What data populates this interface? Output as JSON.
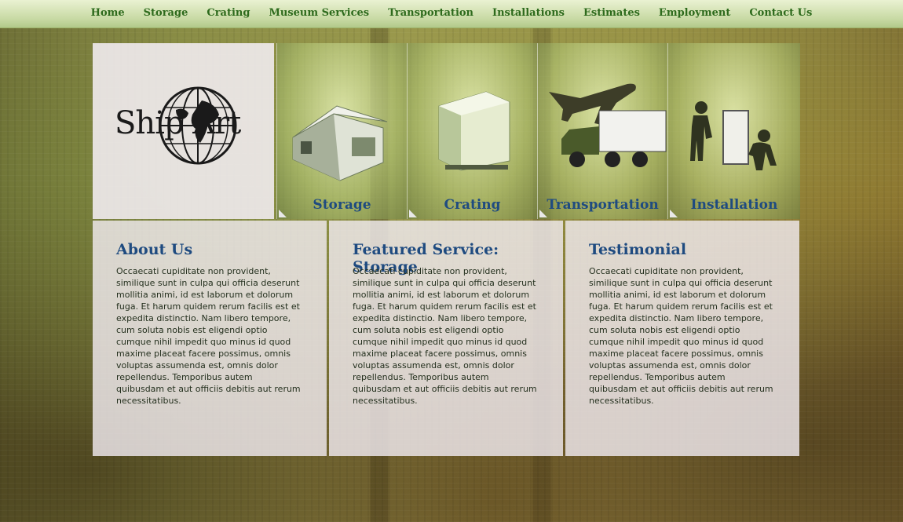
{
  "nav": {
    "items": [
      "Home",
      "Storage",
      "Crating",
      "Museum Services",
      "Transportation",
      "Installations",
      "Estimates",
      "Employment",
      "Contact Us"
    ]
  },
  "logo": {
    "text": "Ship Art"
  },
  "services": [
    {
      "label": "Storage",
      "icon": "warehouse-icon"
    },
    {
      "label": "Crating",
      "icon": "crate-icon"
    },
    {
      "label": "Transportation",
      "icon": "airplane-truck-icon"
    },
    {
      "label": "Installation",
      "icon": "installer-icon"
    }
  ],
  "panels": [
    {
      "title": "About Us",
      "body": "Occaecati cupiditate non provident, similique sunt in culpa qui officia deserunt mollitia animi, id est laborum et dolorum fuga. Et harum quidem rerum facilis est et expedita distinctio. Nam libero tempore, cum soluta nobis est eligendi optio cumque nihil impedit quo minus id quod maxime placeat facere possimus, omnis voluptas assumenda est, omnis dolor repellendus. Temporibus autem quibusdam et aut officiis debitis aut rerum necessitatibus."
    },
    {
      "title": "Featured Service: Storage",
      "body": "Occaecati cupiditate non provident, similique sunt in culpa qui officia deserunt mollitia animi, id est laborum et dolorum fuga. Et harum quidem rerum facilis est et expedita distinctio. Nam libero tempore, cum soluta nobis est eligendi optio cumque nihil impedit quo minus id quod maxime placeat facere possimus, omnis voluptas assumenda est, omnis dolor repellendus. Temporibus autem quibusdam et aut officiis debitis aut rerum necessitatibus."
    },
    {
      "title": "Testimonial",
      "body": "Occaecati cupiditate non provident, similique sunt in culpa qui officia deserunt mollitia animi, id est laborum et dolorum fuga. Et harum quidem rerum facilis est et expedita distinctio. Nam libero tempore, cum soluta nobis est eligendi optio cumque nihil impedit quo minus id quod maxime placeat facere possimus, omnis voluptas assumenda est, omnis dolor repellendus. Temporibus autem quibusdam et aut officiis debitis aut rerum necessitatibus."
    }
  ],
  "colors": {
    "nav_text": "#2d6a1c",
    "heading": "#1f4b80",
    "panel_bg": "#f4eef4"
  }
}
